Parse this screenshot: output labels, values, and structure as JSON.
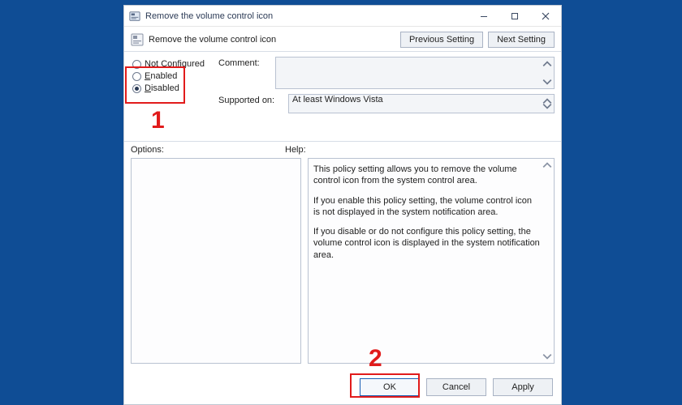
{
  "window": {
    "title": "Remove the volume control icon",
    "controls": {
      "min": "minimize-icon",
      "max": "maximize-icon",
      "close": "close-icon"
    }
  },
  "header": {
    "policy_title": "Remove the volume control icon",
    "prev_label": "Previous Setting",
    "next_label": "Next Setting"
  },
  "state": {
    "radios": {
      "not_configured": "Not Configured",
      "enabled": "Enabled",
      "disabled": "Disabled",
      "selected": "disabled"
    },
    "comment_label": "Comment:",
    "comment_value": "",
    "supported_label": "Supported on:",
    "supported_value": "At least Windows Vista"
  },
  "panes": {
    "options_label": "Options:",
    "help_label": "Help:",
    "help_paragraphs": [
      "This policy setting allows you to remove the volume control icon from the system control area.",
      "If you enable this policy setting, the volume control icon is not displayed in the system notification area.",
      "If you disable or do not configure this policy setting, the volume control icon is displayed in the system notification area."
    ]
  },
  "buttons": {
    "ok": "OK",
    "cancel": "Cancel",
    "apply": "Apply"
  },
  "annotations": {
    "one": "1",
    "two": "2"
  },
  "colors": {
    "bg": "#0f4d95",
    "accent": "#1a5fb4",
    "highlight": "#e11b1b"
  }
}
